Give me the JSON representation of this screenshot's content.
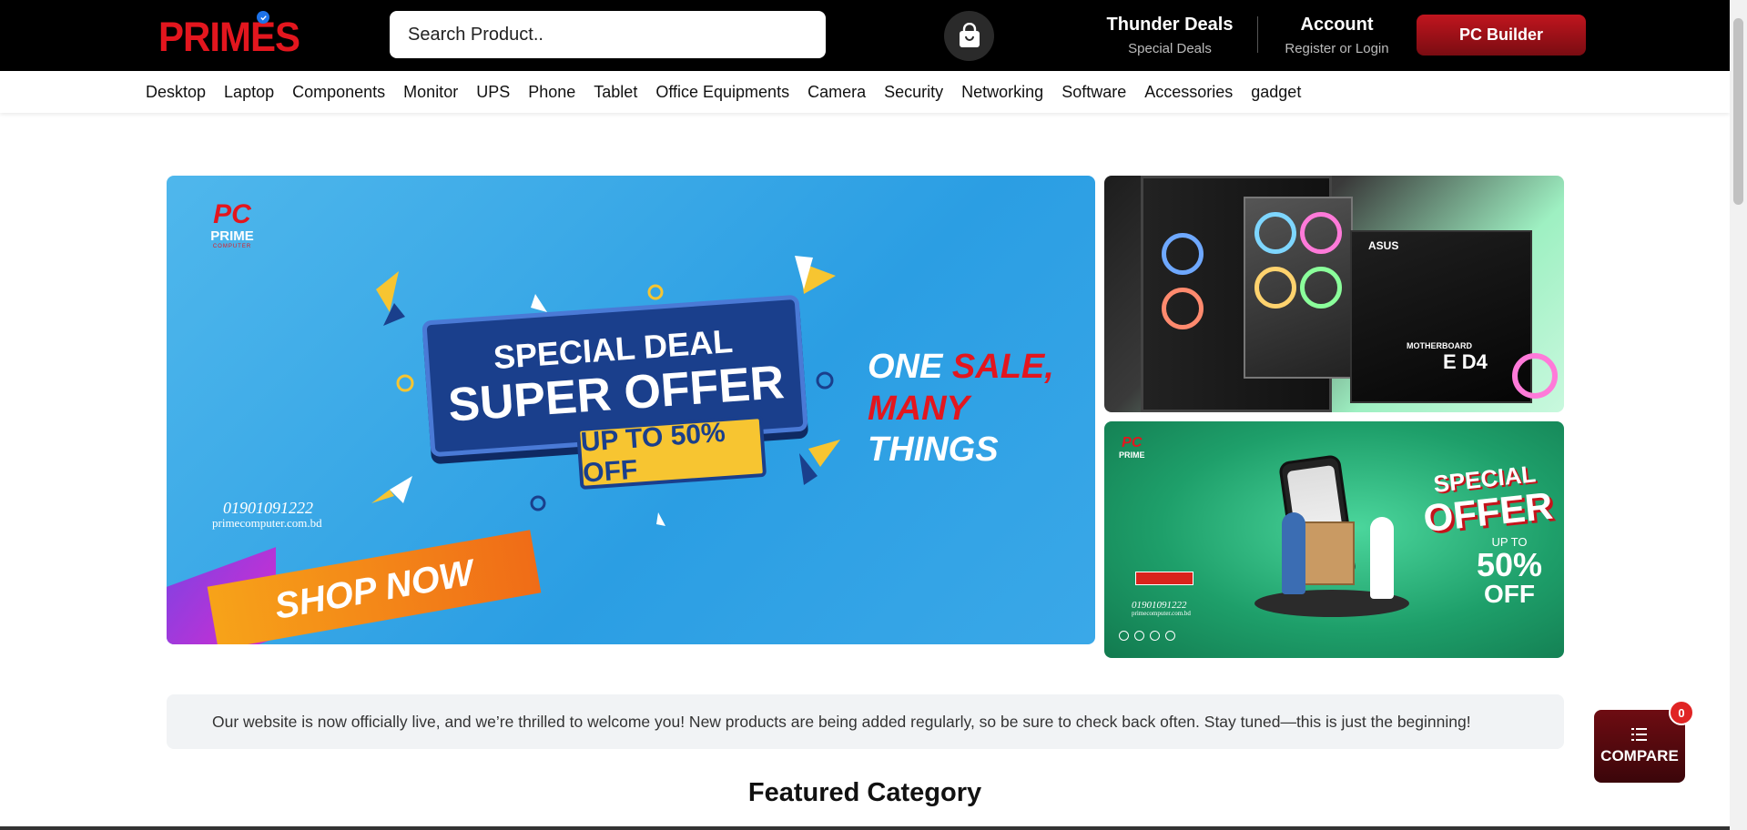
{
  "header": {
    "logo_text": "PRIMES",
    "search": {
      "placeholder": "Search Product.."
    },
    "thunder": {
      "title": "Thunder Deals",
      "subtitle": "Special Deals"
    },
    "account": {
      "title": "Account",
      "subtitle": "Register or Login"
    },
    "pc_builder_label": "PC Builder",
    "brand_color": "#e3161e"
  },
  "nav": {
    "items": [
      {
        "label": "Desktop"
      },
      {
        "label": "Laptop"
      },
      {
        "label": "Components"
      },
      {
        "label": "Monitor"
      },
      {
        "label": "UPS"
      },
      {
        "label": "Phone"
      },
      {
        "label": "Tablet"
      },
      {
        "label": "Office Equipments"
      },
      {
        "label": "Camera"
      },
      {
        "label": "Security"
      },
      {
        "label": "Networking"
      },
      {
        "label": "Software"
      },
      {
        "label": "Accessories"
      },
      {
        "label": "gadget"
      }
    ]
  },
  "banner_main": {
    "logo_pc": "PC",
    "logo_prime": "PRIME",
    "logo_computer": "COMPUTER",
    "headline_1": "SPECIAL DEAL",
    "headline_2": "SUPER OFFER",
    "discount": "UP TO 50% OFF",
    "tagline": {
      "one": "ONE",
      "sale": "SALE,",
      "many": "MANY",
      "things": "THINGS"
    },
    "phone": "01901091222",
    "website": "primecomputer.com.bd",
    "cta": "SHOP NOW"
  },
  "banner_top_right": {
    "brand": "ASUS",
    "motherboard_label": "MOTHERBOARD",
    "model": "E D4"
  },
  "banner_bottom_right": {
    "logo_pc": "PC",
    "logo_prime": "PRIME",
    "special": "SPECIAL",
    "offer": "OFFER",
    "up_to": "UP TO",
    "percent": "50%",
    "off": "OFF",
    "phone": "01901091222",
    "website": "primecomputer.com.bd"
  },
  "notice": {
    "text": "Our website is now officially live, and we’re thrilled to welcome you! New products are being added regularly, so be sure to check back often. Stay tuned—this is just the beginning!"
  },
  "featured": {
    "title": "Featured Category"
  },
  "compare": {
    "label": "COMPARE",
    "count": "0"
  }
}
